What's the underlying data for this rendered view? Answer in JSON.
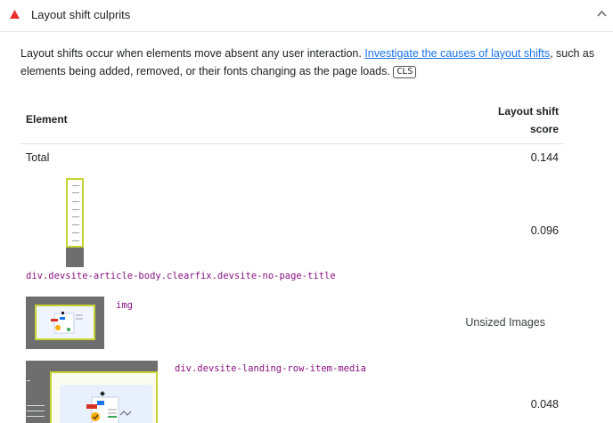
{
  "audit": {
    "title": "Layout shift culprits",
    "status_color": "#e8312e",
    "expand_icon": "chevron-up-icon"
  },
  "description": {
    "before": "Layout shifts occur when elements move absent any user interaction. ",
    "link": "Investigate the causes of layout shifts",
    "after": ", such as elements being added, removed, or their fonts changing as the page loads. ",
    "badge": "CLS"
  },
  "table": {
    "headers": {
      "element": "Element",
      "score": "Layout shift score"
    },
    "total": {
      "label": "Total",
      "value": "0.144"
    },
    "rows": [
      {
        "selector": "div.devsite-article-body.clearfix.devsite-no-page-title",
        "score": "0.096"
      },
      {
        "selector": "img",
        "reason": "Unsized Images"
      },
      {
        "selector": "div.devsite-landing-row-item-media",
        "score": "0.048"
      }
    ]
  }
}
